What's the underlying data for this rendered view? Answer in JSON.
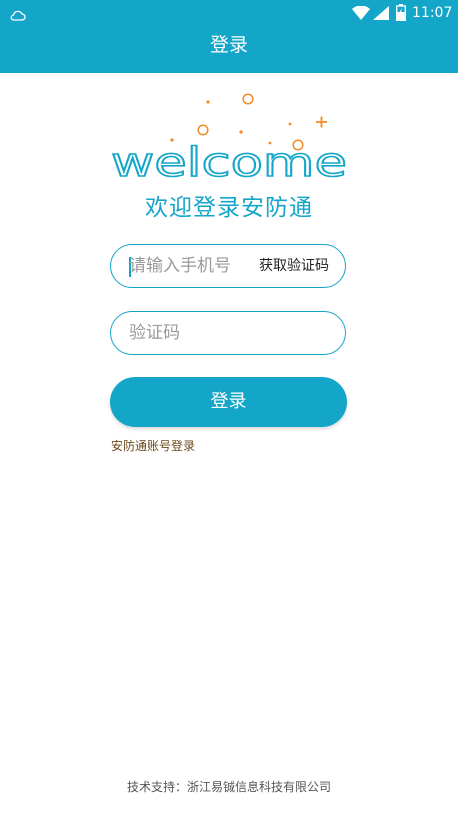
{
  "status_bar": {
    "time": "11:07"
  },
  "header": {
    "title": "登录"
  },
  "welcome": {
    "word": "welcome",
    "subtitle": "欢迎登录安防通",
    "colors": {
      "word": "#14a6c9",
      "dots": "#f08a24"
    }
  },
  "form": {
    "phone_placeholder": "请输入手机号",
    "get_code_label": "获取验证码",
    "code_placeholder": "验证码",
    "login_label": "登录",
    "account_login_link": "安防通账号登录"
  },
  "footer": {
    "text": "技术支持：浙江易铖信息科技有限公司"
  },
  "theme": {
    "accent": "#14a6c9"
  }
}
